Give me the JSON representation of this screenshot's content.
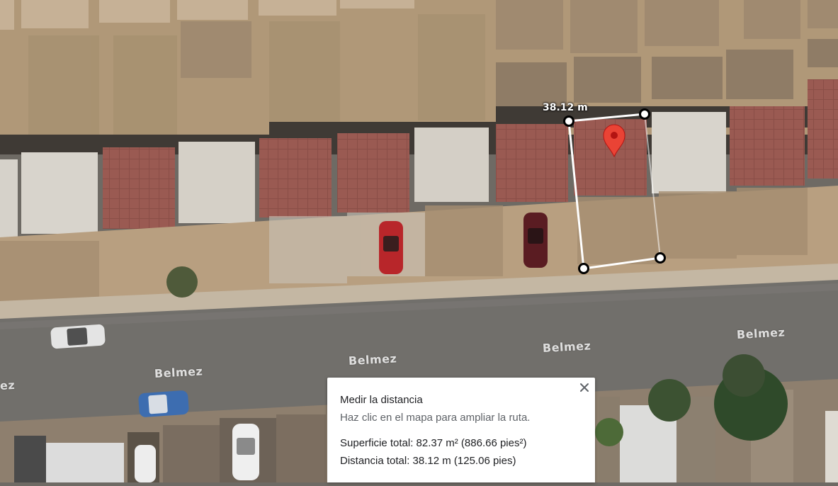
{
  "map": {
    "street_labels": [
      "Belmez",
      "Belmez",
      "Belmez",
      "Belmez",
      "ez"
    ],
    "measure_label": "38.12 m",
    "colors": {
      "road": "#6f6d6a",
      "roof_red": "#9a5a52",
      "roof_white": "#d8d4cc",
      "ground": "#b49a7c",
      "measure_line": "#ffffff",
      "pin": "#ea4335"
    },
    "icons": [
      "map-pin-icon",
      "measure-vertex-icon",
      "close-icon"
    ]
  },
  "panel": {
    "title": "Medir la distancia",
    "hint": "Haz clic en el mapa para ampliar la ruta.",
    "area_text": "Superficie total: 82.37 m² (886.66 pies²)",
    "distance_text": "Distancia total: 38.12 m (125.06 pies)"
  }
}
